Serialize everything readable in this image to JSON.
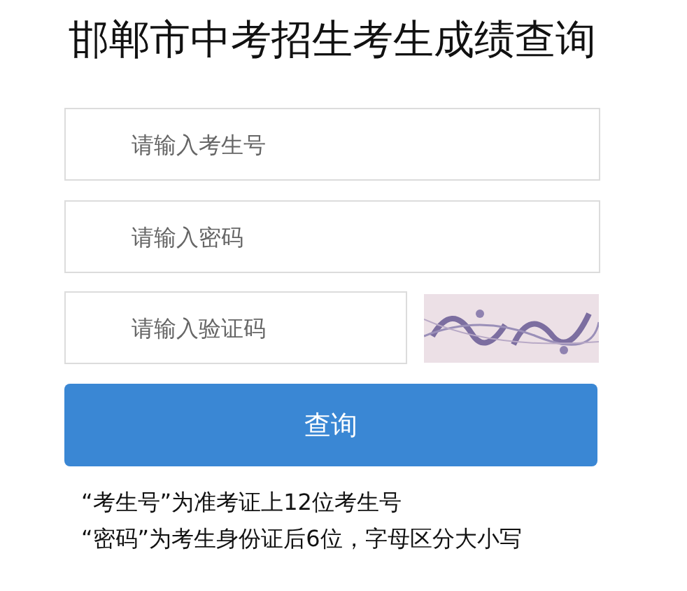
{
  "title": "邯郸市中考招生考生成绩查询",
  "fields": [
    {
      "placeholder": "请输入考生号"
    },
    {
      "placeholder": "请输入密码"
    }
  ],
  "captcha": {
    "placeholder": "请输入验证码"
  },
  "button": "查询",
  "notes": [
    "“考生号”为准考证上12位考生号",
    "“密码”为考生身份证后6位，字母区分大小写"
  ]
}
